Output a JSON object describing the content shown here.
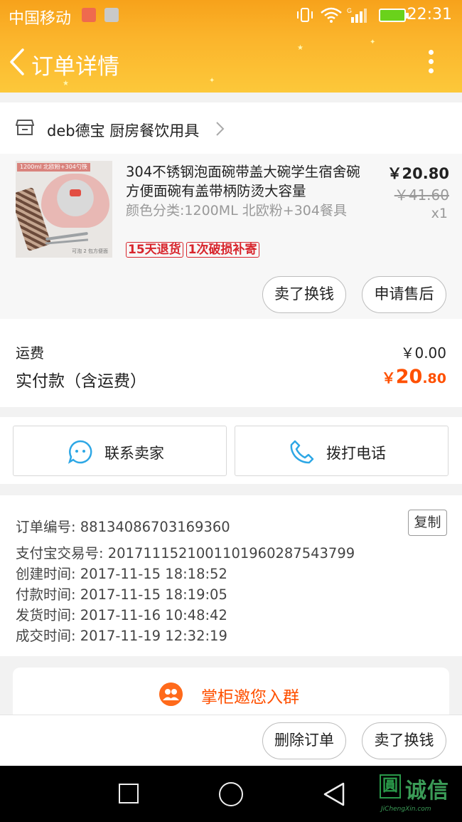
{
  "status_bar": {
    "carrier": "中国移动",
    "time": "22:31",
    "colors": {
      "battery": "#6ad21b"
    }
  },
  "header": {
    "title": "订单详情",
    "back_icon": "chevron-left-icon",
    "more_icon": "more-vertical-icon"
  },
  "shop": {
    "name": "deb德宝 厨房餐饮用具",
    "icon": "store-icon"
  },
  "product": {
    "image_tag": "1200ml 北欧粉+304勺筷",
    "image_caption": "可泡 2 包方便面",
    "title": "304不锈钢泡面碗带盖大碗学生宿舍碗方便面碗有盖带柄防烫大容量",
    "spec": "颜色分类:1200ML 北欧粉+304餐具",
    "badges": [
      "15天退货",
      "1次破损补寄"
    ],
    "price": "￥20.80",
    "original_price": "￥41.60",
    "quantity": "x1",
    "buttons": {
      "resell": "卖了换钱",
      "after_sale": "申请售后"
    }
  },
  "fees": {
    "shipping_label": "运费",
    "shipping_value": "￥0.00",
    "total_label": "实付款（含运费）",
    "total_symbol": "￥",
    "total_int": "20",
    "total_dec": ".80",
    "colors": {
      "total": "#ff5000"
    }
  },
  "contact": {
    "seller_label": "联系卖家",
    "seller_icon": "chat-bubble-icon",
    "phone_label": "拨打电话",
    "phone_icon": "phone-icon",
    "colors": {
      "icon": "#2da7e5"
    }
  },
  "order_info": {
    "copy_label": "复制",
    "rows": [
      "订单编号: 88134086703169360",
      "支付宝交易号: 2017111521001101960287543799",
      "创建时间: 2017-11-15 18:18:52",
      "付款时间: 2017-11-15 18:19:05",
      "发货时间: 2017-11-16 10:48:42",
      "成交时间: 2017-11-19 12:32:19"
    ]
  },
  "group": {
    "label": "掌柜邀您入群",
    "icon": "group-icon"
  },
  "bottom_actions": {
    "delete_order": "删除订单",
    "resell": "卖了换钱"
  },
  "watermark": {
    "box_char": "圓",
    "text": "诚信",
    "sub": "JiChengXin.com"
  }
}
